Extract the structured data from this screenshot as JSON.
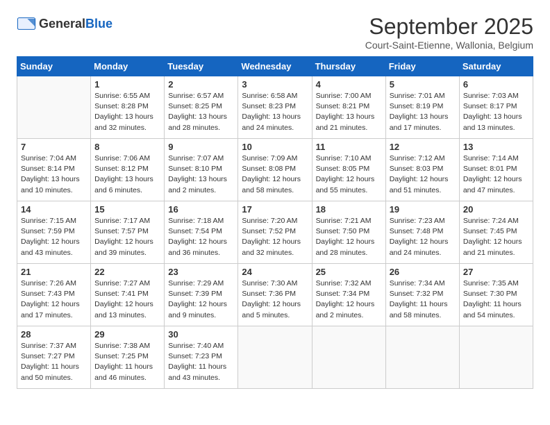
{
  "header": {
    "logo_general": "General",
    "logo_blue": "Blue",
    "month": "September 2025",
    "location": "Court-Saint-Etienne, Wallonia, Belgium"
  },
  "weekdays": [
    "Sunday",
    "Monday",
    "Tuesday",
    "Wednesday",
    "Thursday",
    "Friday",
    "Saturday"
  ],
  "weeks": [
    [
      {
        "day": "",
        "info": ""
      },
      {
        "day": "1",
        "info": "Sunrise: 6:55 AM\nSunset: 8:28 PM\nDaylight: 13 hours\nand 32 minutes."
      },
      {
        "day": "2",
        "info": "Sunrise: 6:57 AM\nSunset: 8:25 PM\nDaylight: 13 hours\nand 28 minutes."
      },
      {
        "day": "3",
        "info": "Sunrise: 6:58 AM\nSunset: 8:23 PM\nDaylight: 13 hours\nand 24 minutes."
      },
      {
        "day": "4",
        "info": "Sunrise: 7:00 AM\nSunset: 8:21 PM\nDaylight: 13 hours\nand 21 minutes."
      },
      {
        "day": "5",
        "info": "Sunrise: 7:01 AM\nSunset: 8:19 PM\nDaylight: 13 hours\nand 17 minutes."
      },
      {
        "day": "6",
        "info": "Sunrise: 7:03 AM\nSunset: 8:17 PM\nDaylight: 13 hours\nand 13 minutes."
      }
    ],
    [
      {
        "day": "7",
        "info": "Sunrise: 7:04 AM\nSunset: 8:14 PM\nDaylight: 13 hours\nand 10 minutes."
      },
      {
        "day": "8",
        "info": "Sunrise: 7:06 AM\nSunset: 8:12 PM\nDaylight: 13 hours\nand 6 minutes."
      },
      {
        "day": "9",
        "info": "Sunrise: 7:07 AM\nSunset: 8:10 PM\nDaylight: 13 hours\nand 2 minutes."
      },
      {
        "day": "10",
        "info": "Sunrise: 7:09 AM\nSunset: 8:08 PM\nDaylight: 12 hours\nand 58 minutes."
      },
      {
        "day": "11",
        "info": "Sunrise: 7:10 AM\nSunset: 8:05 PM\nDaylight: 12 hours\nand 55 minutes."
      },
      {
        "day": "12",
        "info": "Sunrise: 7:12 AM\nSunset: 8:03 PM\nDaylight: 12 hours\nand 51 minutes."
      },
      {
        "day": "13",
        "info": "Sunrise: 7:14 AM\nSunset: 8:01 PM\nDaylight: 12 hours\nand 47 minutes."
      }
    ],
    [
      {
        "day": "14",
        "info": "Sunrise: 7:15 AM\nSunset: 7:59 PM\nDaylight: 12 hours\nand 43 minutes."
      },
      {
        "day": "15",
        "info": "Sunrise: 7:17 AM\nSunset: 7:57 PM\nDaylight: 12 hours\nand 39 minutes."
      },
      {
        "day": "16",
        "info": "Sunrise: 7:18 AM\nSunset: 7:54 PM\nDaylight: 12 hours\nand 36 minutes."
      },
      {
        "day": "17",
        "info": "Sunrise: 7:20 AM\nSunset: 7:52 PM\nDaylight: 12 hours\nand 32 minutes."
      },
      {
        "day": "18",
        "info": "Sunrise: 7:21 AM\nSunset: 7:50 PM\nDaylight: 12 hours\nand 28 minutes."
      },
      {
        "day": "19",
        "info": "Sunrise: 7:23 AM\nSunset: 7:48 PM\nDaylight: 12 hours\nand 24 minutes."
      },
      {
        "day": "20",
        "info": "Sunrise: 7:24 AM\nSunset: 7:45 PM\nDaylight: 12 hours\nand 21 minutes."
      }
    ],
    [
      {
        "day": "21",
        "info": "Sunrise: 7:26 AM\nSunset: 7:43 PM\nDaylight: 12 hours\nand 17 minutes."
      },
      {
        "day": "22",
        "info": "Sunrise: 7:27 AM\nSunset: 7:41 PM\nDaylight: 12 hours\nand 13 minutes."
      },
      {
        "day": "23",
        "info": "Sunrise: 7:29 AM\nSunset: 7:39 PM\nDaylight: 12 hours\nand 9 minutes."
      },
      {
        "day": "24",
        "info": "Sunrise: 7:30 AM\nSunset: 7:36 PM\nDaylight: 12 hours\nand 5 minutes."
      },
      {
        "day": "25",
        "info": "Sunrise: 7:32 AM\nSunset: 7:34 PM\nDaylight: 12 hours\nand 2 minutes."
      },
      {
        "day": "26",
        "info": "Sunrise: 7:34 AM\nSunset: 7:32 PM\nDaylight: 11 hours\nand 58 minutes."
      },
      {
        "day": "27",
        "info": "Sunrise: 7:35 AM\nSunset: 7:30 PM\nDaylight: 11 hours\nand 54 minutes."
      }
    ],
    [
      {
        "day": "28",
        "info": "Sunrise: 7:37 AM\nSunset: 7:27 PM\nDaylight: 11 hours\nand 50 minutes."
      },
      {
        "day": "29",
        "info": "Sunrise: 7:38 AM\nSunset: 7:25 PM\nDaylight: 11 hours\nand 46 minutes."
      },
      {
        "day": "30",
        "info": "Sunrise: 7:40 AM\nSunset: 7:23 PM\nDaylight: 11 hours\nand 43 minutes."
      },
      {
        "day": "",
        "info": ""
      },
      {
        "day": "",
        "info": ""
      },
      {
        "day": "",
        "info": ""
      },
      {
        "day": "",
        "info": ""
      }
    ]
  ]
}
